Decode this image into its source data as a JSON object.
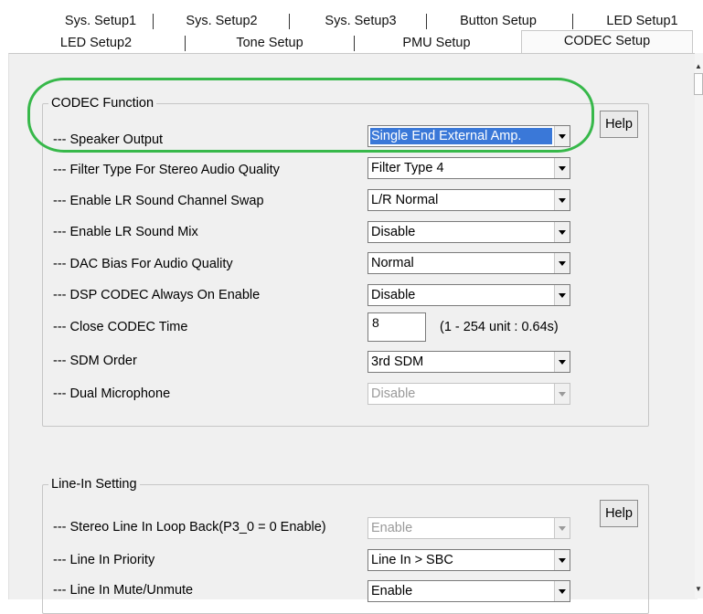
{
  "tabs": {
    "row1": [
      "Sys. Setup1",
      "Sys. Setup2",
      "Sys. Setup3",
      "Button Setup",
      "LED Setup1"
    ],
    "row2": [
      "LED Setup2",
      "Tone Setup",
      "PMU Setup",
      "CODEC Setup"
    ],
    "active": "CODEC Setup"
  },
  "codec": {
    "title": "CODEC Function",
    "help": "Help",
    "rows": [
      {
        "label": "--- Speaker Output",
        "value": "Single End External Amp."
      },
      {
        "label": "--- Filter Type For Stereo Audio Quality",
        "value": "Filter Type 4"
      },
      {
        "label": "--- Enable LR Sound Channel Swap",
        "value": "L/R Normal"
      },
      {
        "label": "--- Enable LR Sound Mix",
        "value": "Disable"
      },
      {
        "label": "--- DAC Bias For Audio Quality",
        "value": "Normal"
      },
      {
        "label": "--- DSP CODEC Always On Enable",
        "value": "Disable"
      },
      {
        "label": "--- Close CODEC Time",
        "value": "8",
        "note": "(1 - 254 unit : 0.64s)"
      },
      {
        "label": "--- SDM Order",
        "value": "3rd SDM"
      },
      {
        "label": "--- Dual Microphone",
        "value": "Disable"
      }
    ]
  },
  "linein": {
    "title": "Line-In Setting",
    "help": "Help",
    "rows": [
      {
        "label": "--- Stereo Line In Loop Back(P3_0 = 0 Enable)",
        "value": "Enable"
      },
      {
        "label": "--- Line In Priority",
        "value": "Line In > SBC"
      },
      {
        "label": "--- Line In Mute/Unmute",
        "value": "Enable"
      }
    ]
  },
  "highlight_color": "#37b84a",
  "selection_color": "#3a78d8"
}
